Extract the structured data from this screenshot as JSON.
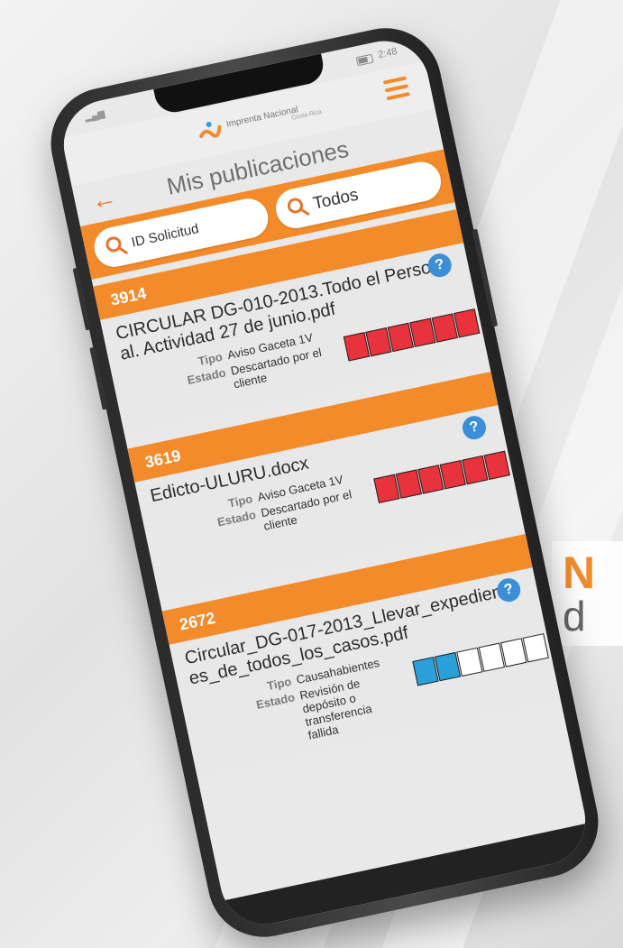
{
  "statusbar": {
    "time": "2:48"
  },
  "header": {
    "logo_name": "Imprenta Nacional",
    "logo_sub": "Costa Rica"
  },
  "page": {
    "title": "Mis publicaciones",
    "back_icon": "arrow-left-icon",
    "menu_icon": "hamburger-icon"
  },
  "search": {
    "id_label": "ID Solicitud",
    "filter_label": "Todos",
    "icon": "search-icon"
  },
  "labels": {
    "tipo": "Tipo",
    "estado": "Estado"
  },
  "publications": [
    {
      "id": "3914",
      "filename": "CIRCULAR DG-010-2013.Todo el Personal. Actividad 27 de junio.pdf",
      "tipo": "Aviso Gaceta 1V",
      "estado": "Descartado por el cliente",
      "progress_color": "#e8323c",
      "progress_filled": 6,
      "progress_total": 6
    },
    {
      "id": "3619",
      "filename": "Edicto-ULURU.docx",
      "tipo": "Aviso Gaceta 1V",
      "estado": "Descartado por el cliente",
      "progress_color": "#e8323c",
      "progress_filled": 6,
      "progress_total": 6
    },
    {
      "id": "2672",
      "filename": "Circular_DG-017-2013_Llevar_expedientes_de_todos_los_casos.pdf",
      "tipo": "Causahabientes",
      "estado": "Revisión de depósito o transferencia fallida",
      "progress_color": "#2a9fd8",
      "progress_filled": 2,
      "progress_total": 6
    }
  ],
  "tagline": {
    "line1": "N",
    "line2": "d"
  },
  "colors": {
    "accent": "#f38b2a",
    "help": "#3a8fd8"
  }
}
